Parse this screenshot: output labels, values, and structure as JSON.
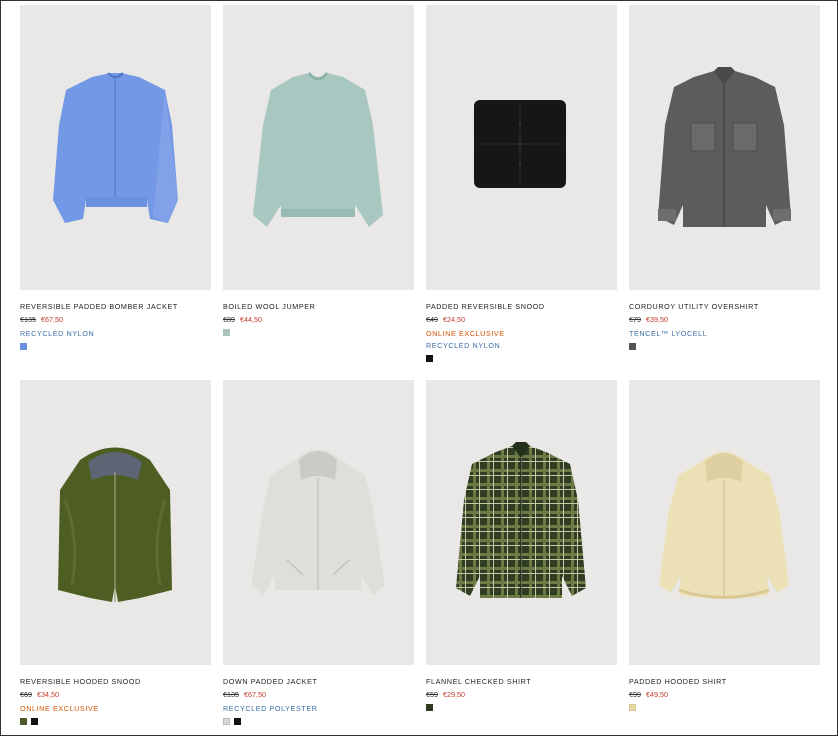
{
  "products": [
    {
      "name": "REVERSIBLE PADDED BOMBER JACKET",
      "old_price": "€135",
      "new_price": "€67,50",
      "tags": [
        {
          "text": "RECYCLED NYLON",
          "color": "blue"
        }
      ],
      "swatches": [
        "#6d8fe0"
      ],
      "image": "bomber-jacket-blue"
    },
    {
      "name": "BOILED WOOL JUMPER",
      "old_price": "€89",
      "new_price": "€44,50",
      "tags": [],
      "swatches": [
        "#a9c4bd"
      ],
      "image": "wool-jumper-mint"
    },
    {
      "name": "PADDED REVERSIBLE SNOOD",
      "old_price": "€49",
      "new_price": "€24,50",
      "tags": [
        {
          "text": "ONLINE EXCLUSIVE",
          "color": "orange"
        },
        {
          "text": "RECYCLED NYLON",
          "color": "blue"
        }
      ],
      "swatches": [
        "#111111"
      ],
      "image": "snood-black"
    },
    {
      "name": "CORDUROY UTILITY OVERSHIRT",
      "old_price": "€79",
      "new_price": "€39,50",
      "tags": [
        {
          "text": "TENCEL™ LYOCELL",
          "color": "blue"
        }
      ],
      "swatches": [
        "#555555"
      ],
      "image": "overshirt-grey"
    },
    {
      "name": "REVERSIBLE HOODED SNOOD",
      "old_price": "€69",
      "new_price": "€34,50",
      "tags": [
        {
          "text": "ONLINE EXCLUSIVE",
          "color": "orange"
        }
      ],
      "swatches": [
        "#4a5a2a",
        "#111111"
      ],
      "image": "hooded-snood-olive"
    },
    {
      "name": "DOWN PADDED JACKET",
      "old_price": "€135",
      "new_price": "€67,50",
      "tags": [
        {
          "text": "RECYCLED POLYESTER",
          "color": "blue"
        }
      ],
      "swatches": [
        "#d9d9d4",
        "#111111"
      ],
      "image": "down-jacket-stone"
    },
    {
      "name": "FLANNEL CHECKED SHIRT",
      "old_price": "€59",
      "new_price": "€29,50",
      "tags": [],
      "swatches": [
        "#2e3a20"
      ],
      "image": "flannel-shirt-green"
    },
    {
      "name": "PADDED HOODED SHIRT",
      "old_price": "€99",
      "new_price": "€49,50",
      "tags": [],
      "swatches": [
        "#e6d7a5"
      ],
      "image": "hooded-shirt-beige"
    }
  ]
}
